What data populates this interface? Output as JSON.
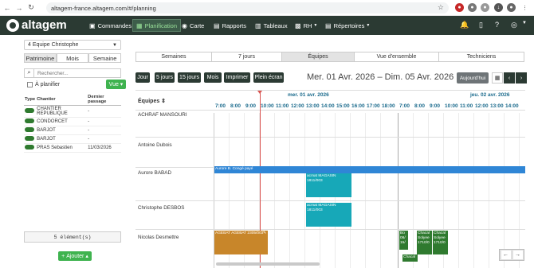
{
  "browser": {
    "url": "altagem-france.altagem.com/#/planning"
  },
  "app": {
    "logo": "altagem",
    "menu": [
      "Commandes",
      "Planification",
      "Carte",
      "Rapports",
      "Tableaux",
      "RH",
      "Répertoires"
    ]
  },
  "left": {
    "team": "4 Equipe Christophe",
    "segs": [
      "Patrimoine",
      "Mois",
      "Semaine"
    ],
    "search_placeholder": "Rechercher...",
    "filter_label": "À planifier",
    "vue_label": "Vue",
    "cols": [
      "Type",
      "Chantier",
      "Dernier passage"
    ],
    "rows": [
      {
        "chantier": "CHANTIER REPUBLIQUE",
        "last": "-"
      },
      {
        "chantier": "CONDORCET",
        "last": "-"
      },
      {
        "chantier": "BARJOT",
        "last": "-"
      },
      {
        "chantier": "BARJOT",
        "last": "-"
      },
      {
        "chantier": "PRAS Sebastien",
        "last": "11/03/2026"
      }
    ],
    "count": "5 élément(s)",
    "add": "Ajouter"
  },
  "tabs": [
    "Semaines",
    "7 jours",
    "Équipes",
    "Vue d'ensemble",
    "Techniciens"
  ],
  "toolbar": {
    "buttons": [
      "Jour",
      "5 jours",
      "15 jours",
      "Mois",
      "Imprimer",
      "Plein écran"
    ],
    "range": "Mer. 01 Avr. 2026 – Dim. 05 Avr. 2026",
    "today": "Aujourd'hui"
  },
  "grid": {
    "eq_header": "Équipes",
    "dates": [
      "mer. 01 avr. 2026",
      "jeu. 02 avr. 2026"
    ],
    "hours": [
      "7:00",
      "8:00",
      "9:00",
      "10:00",
      "11:00",
      "12:00",
      "13:00",
      "14:00",
      "15:00",
      "16:00",
      "17:00",
      "18:00",
      "7:00",
      "8:00",
      "9:00",
      "10:00",
      "11:00",
      "12:00",
      "13:00",
      "14:00"
    ],
    "teams": [
      "ACHRAF MANSOURI",
      "Antoine Dubois",
      "Aurore BABAD",
      "Christophe DESBOS",
      "Nicolas Desmettre"
    ],
    "events": [
      {
        "text": "Aurore B. Congé payé",
        "color": "#2f86d6"
      },
      {
        "text": "acmat MAGASIN 1811/003",
        "color": "#17a8b8"
      },
      {
        "text": "acmat MAGASIN 1811/003",
        "color": "#17a8b8"
      },
      {
        "text": "AGEBAT AGEBAT 2305/003",
        "color": "#c8862a"
      },
      {
        "text": "Bo 06/ 15/",
        "color": "#2f7a2f"
      },
      {
        "text": "Chacal Solyee 1710/0",
        "color": "#2f7a2f"
      },
      {
        "text": "Chacal Solyee 1710/0",
        "color": "#2f7a2f"
      },
      {
        "text": "Chacal",
        "color": "#2f7a2f"
      }
    ]
  }
}
